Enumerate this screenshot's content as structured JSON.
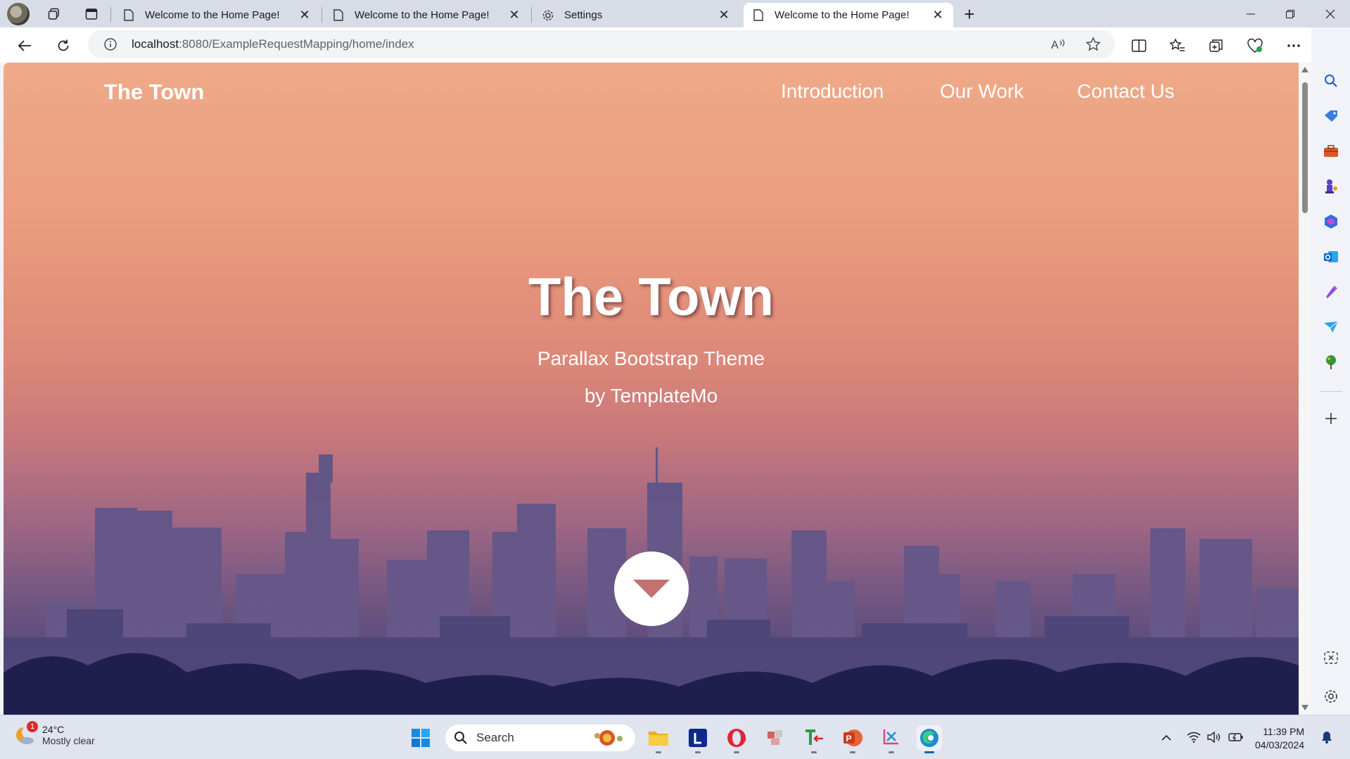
{
  "browser": {
    "tabs": [
      {
        "title": "Welcome to the Home Page!",
        "icon": "page-icon",
        "active": false
      },
      {
        "title": "Welcome to the Home Page!",
        "icon": "page-icon",
        "active": false
      },
      {
        "title": "Settings",
        "icon": "gear-icon",
        "active": false
      },
      {
        "title": "Welcome to the Home Page!",
        "icon": "page-icon",
        "active": true
      }
    ],
    "url_host": "localhost",
    "url_rest": ":8080/ExampleRequestMapping/home/index"
  },
  "site": {
    "brand": "The Town",
    "nav": [
      "Introduction",
      "Our Work",
      "Contact Us"
    ],
    "hero": {
      "title": "The Town",
      "subtitle": "Parallax Bootstrap Theme",
      "byline": "by TemplateMo"
    }
  },
  "taskbar": {
    "weather": {
      "temp": "24°C",
      "condition": "Mostly clear",
      "badge": "1"
    },
    "search_label": "Search",
    "time": "11:39 PM",
    "date": "04/03/2024"
  },
  "colors": {
    "sky_top": "#eeaa88",
    "sky_bottom": "#2d2c58",
    "accent_edge": "#0067c0"
  }
}
